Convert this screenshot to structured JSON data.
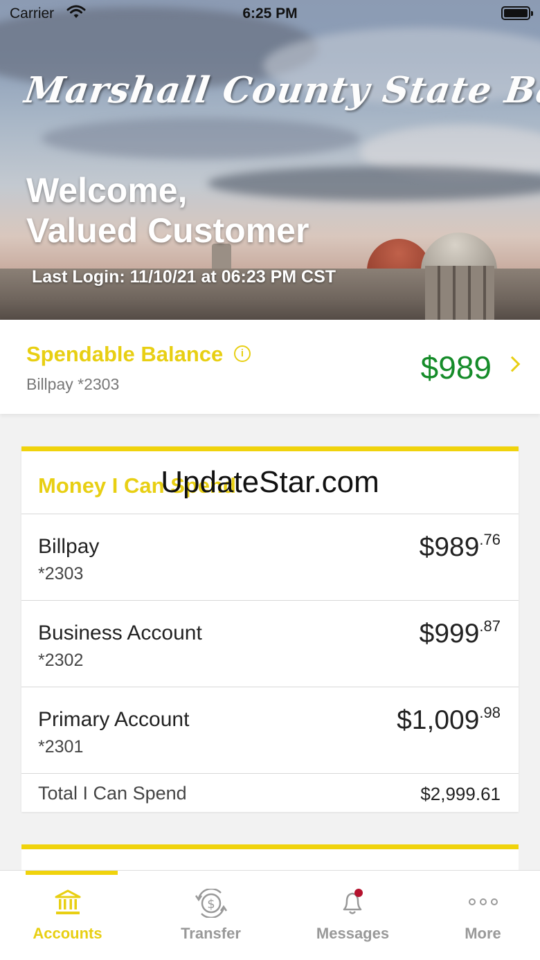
{
  "status_bar": {
    "carrier": "Carrier",
    "time": "6:25 PM"
  },
  "hero": {
    "bank_name": "Marshall County State Bank",
    "welcome_line1": "Welcome,",
    "welcome_line2": "Valued Customer",
    "last_login": "Last Login: 11/10/21 at 06:23 PM CST"
  },
  "spendable": {
    "title": "Spendable Balance",
    "info_glyph": "i",
    "account": "Billpay *2303",
    "amount": "$989"
  },
  "money_card": {
    "title": "Money I Can Spend",
    "watermark": "UpdateStar.com",
    "accounts": [
      {
        "name": "Billpay",
        "number": "*2303",
        "dollars": "$989",
        "cents": ".76"
      },
      {
        "name": "Business Account",
        "number": "*2302",
        "dollars": "$999",
        "cents": ".87"
      },
      {
        "name": "Primary Account",
        "number": "*2301",
        "dollars": "$1,009",
        "cents": ".98"
      }
    ],
    "total_label": "Total I Can Spend",
    "total_value": "$2,999.61"
  },
  "tabs": [
    {
      "label": "Accounts",
      "icon": "bank-icon",
      "active": true
    },
    {
      "label": "Transfer",
      "icon": "transfer-icon",
      "active": false
    },
    {
      "label": "Messages",
      "icon": "bell-icon",
      "active": false
    },
    {
      "label": "More",
      "icon": "more-dots-icon",
      "active": false
    }
  ],
  "colors": {
    "accent": "#f0d30c",
    "balance_green": "#168c2a",
    "notification_dot": "#b5122e"
  }
}
